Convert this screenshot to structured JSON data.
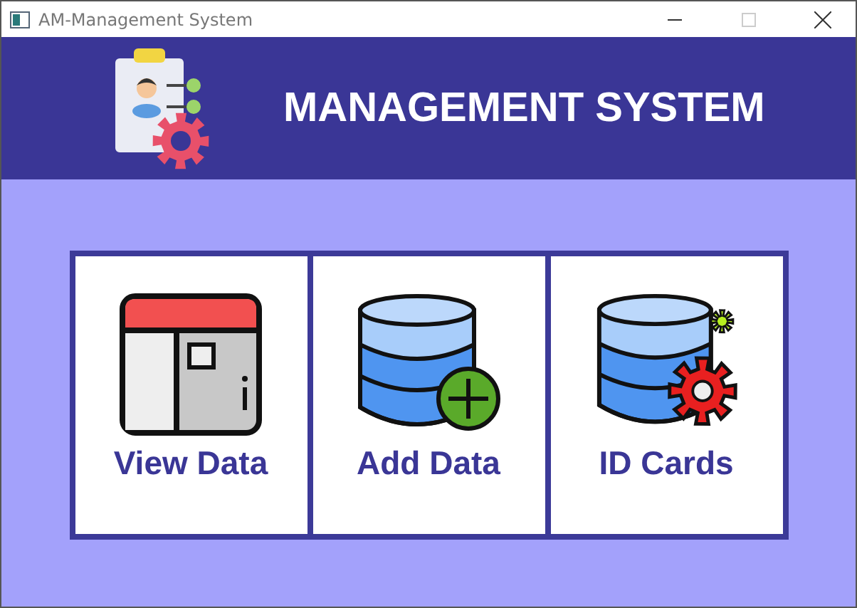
{
  "window": {
    "title": "AM-Management System"
  },
  "header": {
    "title": "MANAGEMENT SYSTEM"
  },
  "cards": [
    {
      "kind": "cabinet",
      "label": "View Data"
    },
    {
      "kind": "add",
      "label": "Add Data"
    },
    {
      "kind": "settings",
      "label": "ID Cards"
    }
  ]
}
